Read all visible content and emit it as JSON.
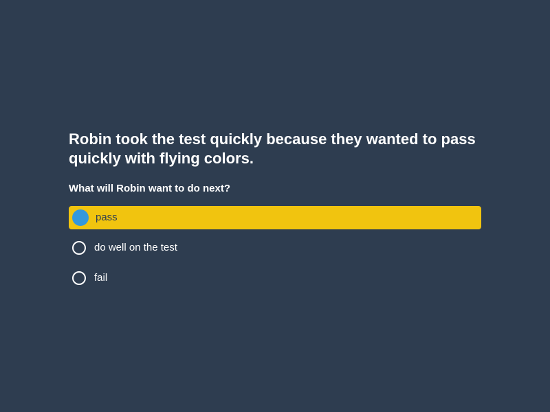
{
  "quiz": {
    "statement": "Robin took the test quickly because they wanted to pass quickly with flying colors.",
    "question": "What will Robin want to do next?",
    "options": [
      {
        "label": "pass",
        "selected": true
      },
      {
        "label": "do well on the test",
        "selected": false
      },
      {
        "label": "fail",
        "selected": false
      }
    ]
  },
  "colors": {
    "background": "#2e3d50",
    "selected_highlight": "#f1c40f",
    "selected_radio": "#3498db",
    "text": "#ffffff"
  }
}
